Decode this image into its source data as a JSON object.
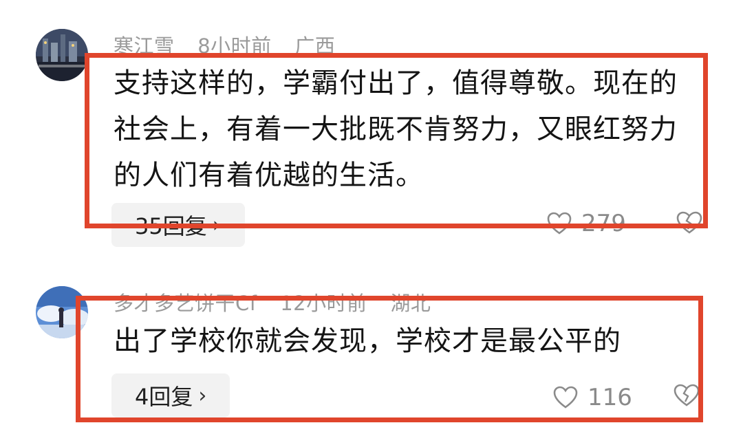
{
  "comments": [
    {
      "username": "寒江雪",
      "time": "8小时前",
      "location": "广西",
      "text": "支持这样的，学霸付出了，值得尊敬。现在的社会上，有着一大批既不肯努力，又眼红努力的人们有着优越的生活。",
      "replies": "35回复",
      "likes": "279"
    },
    {
      "username": "多才多艺饼干Cf",
      "time": "12小时前",
      "location": "湖北",
      "text": "出了学校你就会发现，学校才是最公平的",
      "replies": "4回复",
      "likes": "116"
    }
  ],
  "reply_chevron": "›",
  "highlight_color": "#e0452c",
  "icons": [
    "avatar-night-city",
    "avatar-anime-sky",
    "heart-icon",
    "broken-heart-icon",
    "chevron-right-icon"
  ]
}
